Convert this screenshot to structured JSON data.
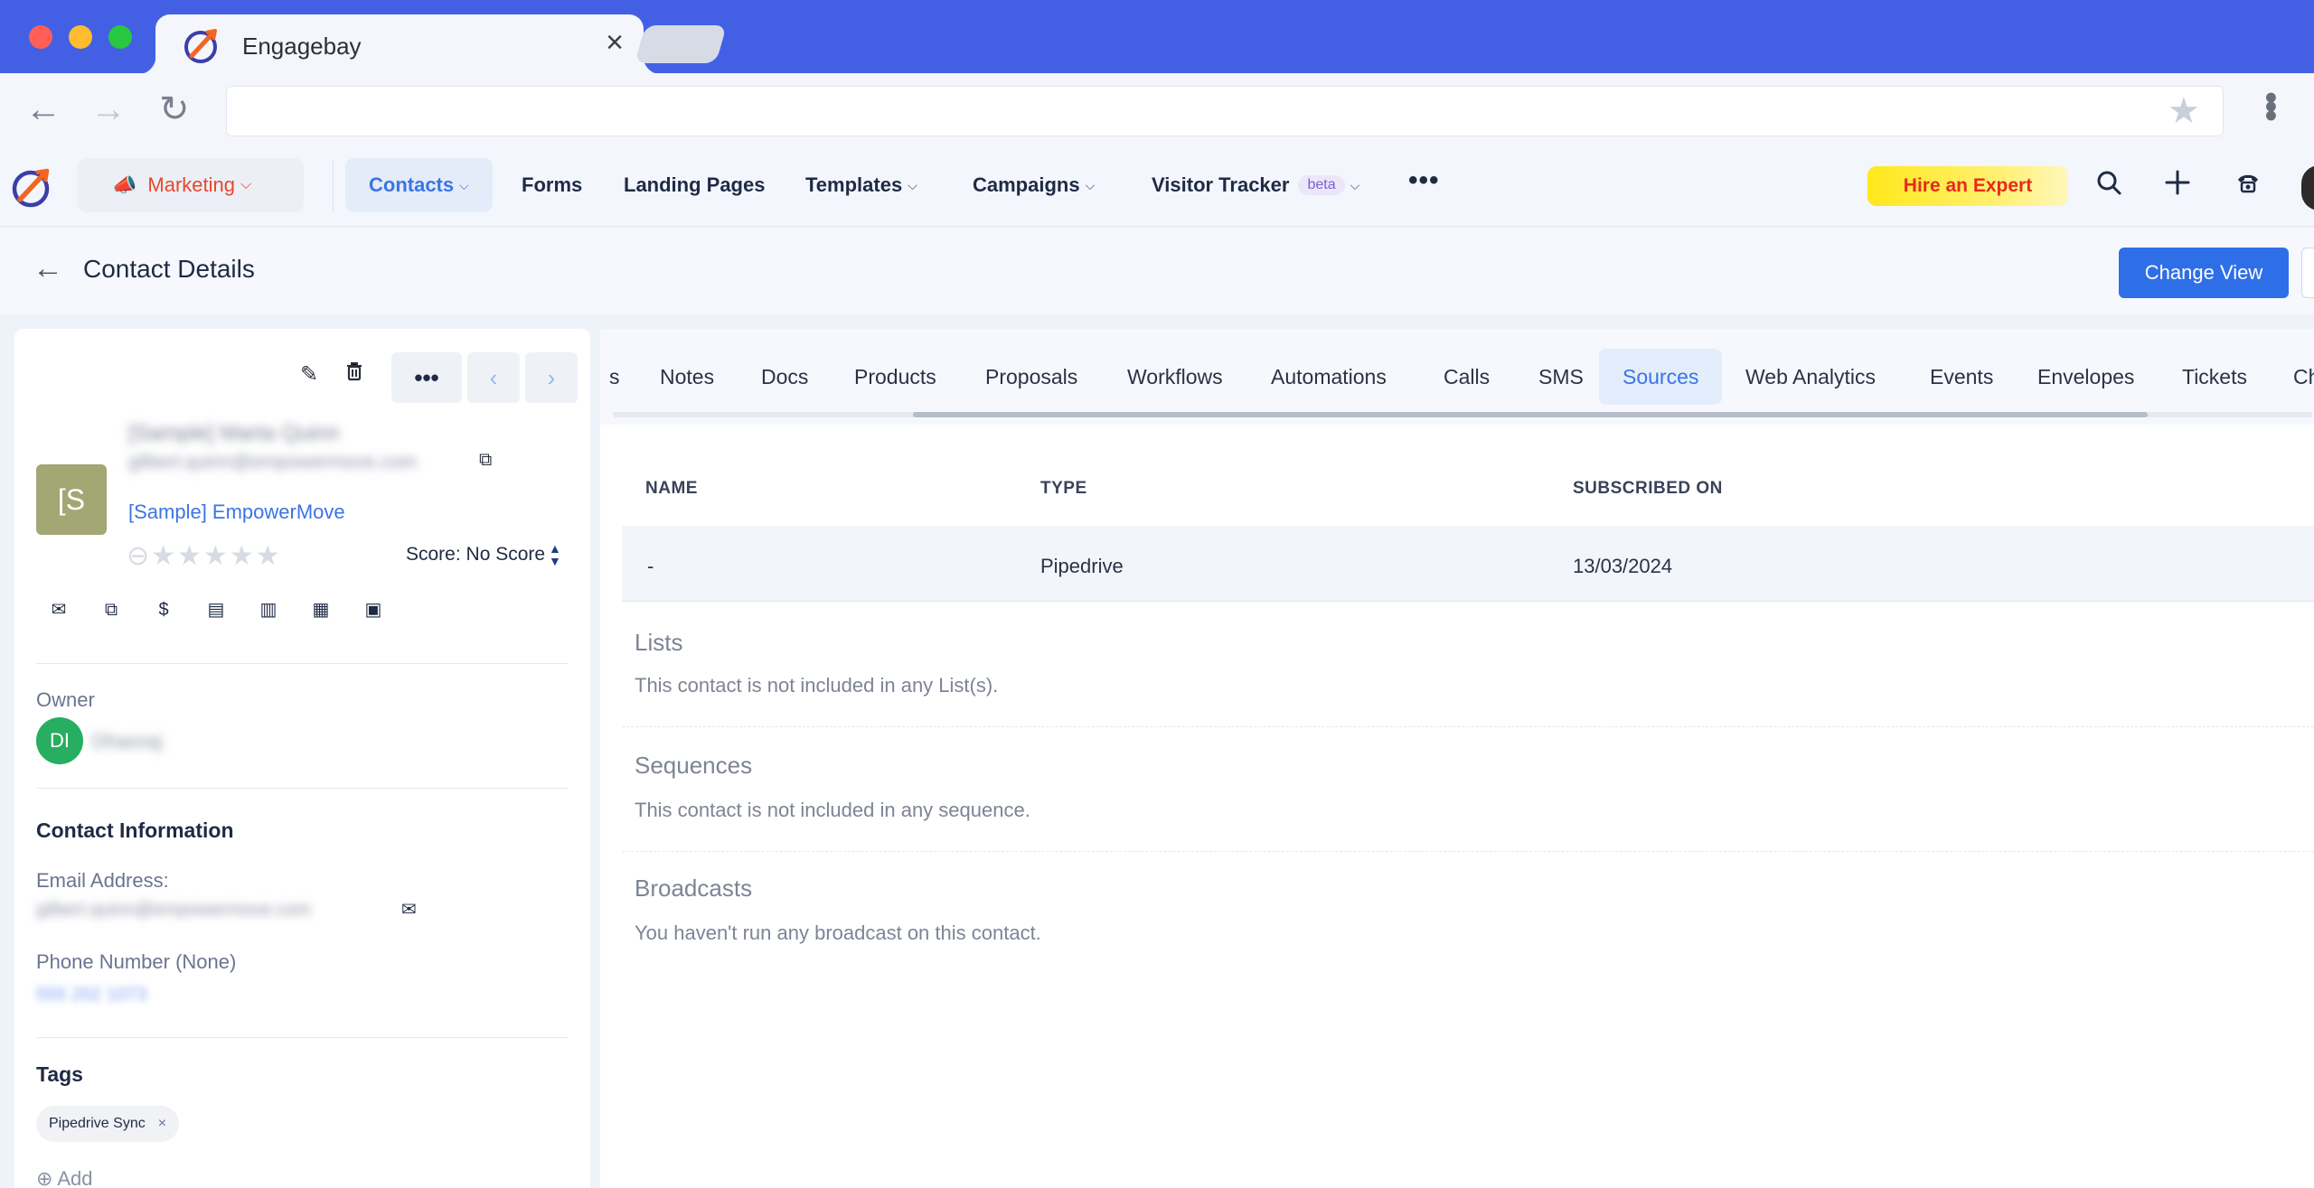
{
  "browser": {
    "tab_title": "Engagebay",
    "tab_close": "×"
  },
  "appnav": {
    "marketing": "Marketing",
    "items": [
      "Contacts",
      "Forms",
      "Landing Pages",
      "Templates",
      "Campaigns",
      "Visitor Tracker"
    ],
    "beta": "beta",
    "more": "•••",
    "hire": "Hire an Expert"
  },
  "page": {
    "title": "Contact Details",
    "change_view": "Change View"
  },
  "contact": {
    "avatar_initials": "[S",
    "name": "[Sample] Marta Quinn",
    "email": "gilbert.quinn@empowermove.com",
    "company": "[Sample] EmpowerMove",
    "score": "Score: No Score",
    "owner_label": "Owner",
    "owner_initials": "DI",
    "owner_name": "Dhanraj",
    "info_heading": "Contact Information",
    "email_label": "Email Address:",
    "email_value": "gilbert.quinn@empowermove.com",
    "phone_label": "Phone Number (None)",
    "phone_value": "555 202 1073",
    "tags_heading": "Tags",
    "tag": "Pipedrive Sync",
    "tag_remove": "×",
    "add_tag": "⊕ Add"
  },
  "tabs": [
    "s",
    "Notes",
    "Docs",
    "Products",
    "Proposals",
    "Workflows",
    "Automations",
    "Calls",
    "SMS",
    "Sources",
    "Web Analytics",
    "Events",
    "Envelopes",
    "Tickets",
    "Ch"
  ],
  "active_tab": "Sources",
  "sources_table": {
    "headers": [
      "NAME",
      "TYPE",
      "SUBSCRIBED ON"
    ],
    "rows": [
      [
        "-",
        "Pipedrive",
        "13/03/2024"
      ]
    ]
  },
  "sections": {
    "lists_title": "Lists",
    "lists_text": "This contact is not included in any List(s).",
    "sequences_title": "Sequences",
    "sequences_text": "This contact is not included in any sequence.",
    "broadcasts_title": "Broadcasts",
    "broadcasts_text": "You haven't run any broadcast on this contact."
  },
  "colors": {
    "browser_bar": "#4360e5",
    "accent": "#3b74e6",
    "marketing": "#e5482c",
    "primary_button": "#2e6fe8",
    "owner_badge": "#27ae60",
    "hire_text": "#e8291f"
  }
}
